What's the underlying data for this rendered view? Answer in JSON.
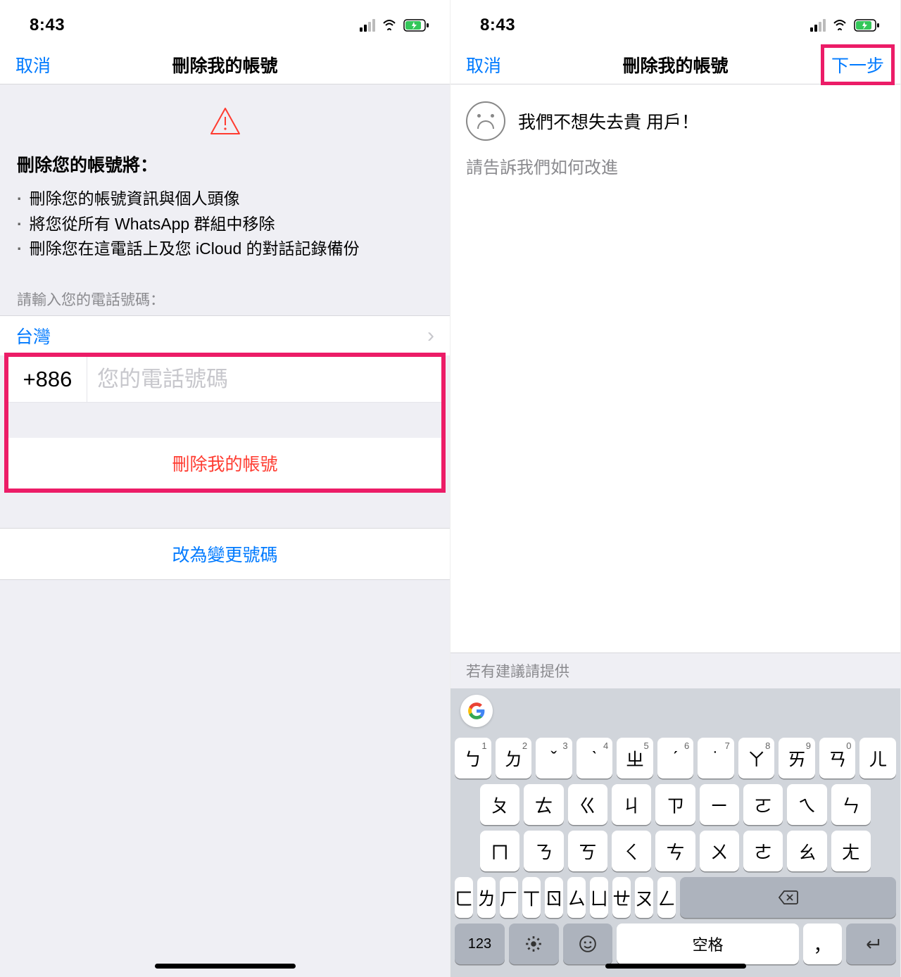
{
  "left": {
    "status_time": "8:43",
    "nav": {
      "cancel": "取消",
      "title": "刪除我的帳號"
    },
    "info_heading": "刪除您的帳號將：",
    "info_items": [
      "刪除您的帳號資訊與個人頭像",
      "將您從所有 WhatsApp 群組中移除",
      "刪除您在這電話上及您 iCloud 的對話記錄備份"
    ],
    "phone_prompt": "請輸入您的電話號碼：",
    "country": "台灣",
    "country_code": "+886",
    "phone_placeholder": "您的電話號碼",
    "delete_button": "刪除我的帳號",
    "change_number": "改為變更號碼"
  },
  "right": {
    "status_time": "8:43",
    "nav": {
      "cancel": "取消",
      "title": "刪除我的帳號",
      "next": "下一步"
    },
    "sad_message": "我們不想失去貴 用戶！",
    "feedback_placeholder": "請告訴我們如何改進",
    "suggest_label": "若有建議請提供",
    "keyboard": {
      "row1": [
        {
          "k": "ㄅ",
          "n": "1"
        },
        {
          "k": "ㄉ",
          "n": "2"
        },
        {
          "k": "ˇ",
          "n": "3"
        },
        {
          "k": "ˋ",
          "n": "4"
        },
        {
          "k": "ㄓ",
          "n": "5"
        },
        {
          "k": "ˊ",
          "n": "6"
        },
        {
          "k": "˙",
          "n": "7"
        },
        {
          "k": "ㄚ",
          "n": "8"
        },
        {
          "k": "ㄞ",
          "n": "9"
        },
        {
          "k": "ㄢ",
          "n": "0"
        },
        {
          "k": "ㄦ",
          "n": ""
        }
      ],
      "row2": [
        "ㄆ",
        "ㄊ",
        "ㄍ",
        "ㄐ",
        "ㄗ",
        "ㄧ",
        "ㄛ",
        "ㄟ",
        "ㄣ"
      ],
      "row3": [
        "ㄇ",
        "ㄋ",
        "ㄎ",
        "ㄑ",
        "ㄘ",
        "ㄨ",
        "ㄜ",
        "ㄠ",
        "ㄤ"
      ],
      "row4": [
        "ㄈ",
        "ㄌ",
        "ㄏ",
        "ㄒ",
        "ㄖ",
        "ㄙ",
        "ㄩ",
        "ㄝ",
        "ㄡ",
        "ㄥ"
      ],
      "row4_del": "⌫",
      "row5": {
        "num": "123",
        "space": "空格",
        "comma": "，",
        "enter": "↵"
      }
    }
  }
}
